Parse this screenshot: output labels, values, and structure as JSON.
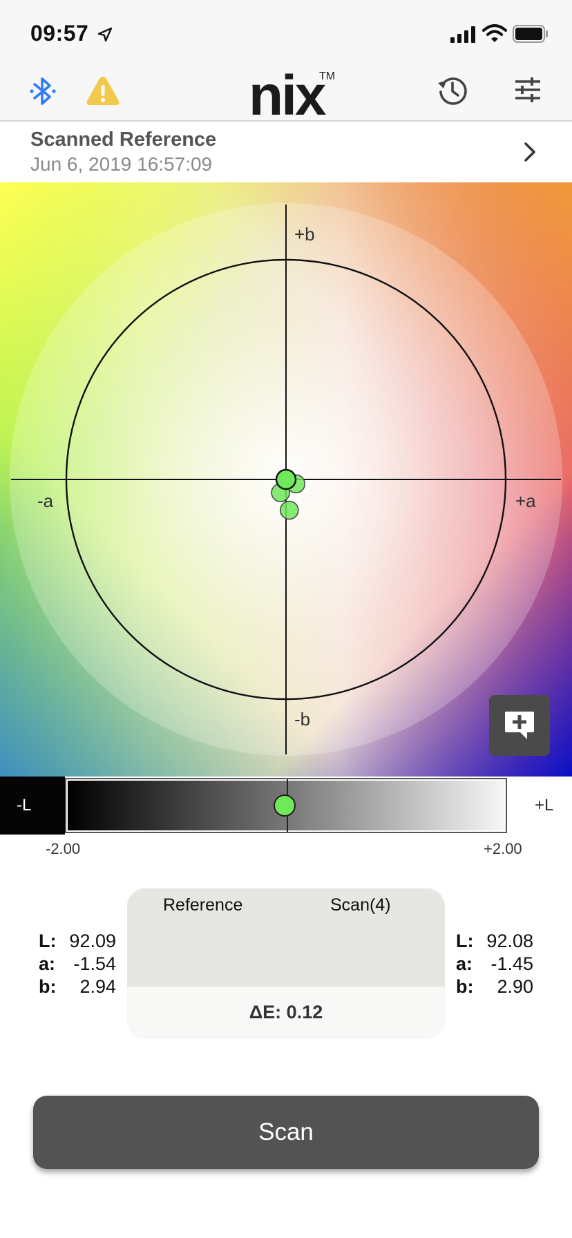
{
  "status_bar": {
    "time": "09:57",
    "icons": [
      "location-arrow-icon",
      "cellular-signal-icon",
      "wifi-icon",
      "battery-icon"
    ]
  },
  "nav": {
    "logo": "nix",
    "logo_mark": "TM",
    "icons": [
      "bluetooth-icon",
      "warning-icon",
      "history-icon",
      "settings-sliders-icon"
    ],
    "colors": {
      "bluetooth": "#2f7bf5",
      "warning": "#f2c94c"
    }
  },
  "reference": {
    "title": "Scanned Reference",
    "date": "Jun 6, 2019  16:57:09"
  },
  "color_map": {
    "axis_labels": {
      "plus_b": "+b",
      "minus_b": "-b",
      "minus_a": "-a",
      "plus_a": "+a"
    },
    "points": [
      {
        "name": "reference",
        "da": 0.0,
        "db": 0.0,
        "color": "#6fe85a"
      },
      {
        "name": "scan-1",
        "da": 0.09,
        "db": -0.04,
        "color": "#6fe85a"
      },
      {
        "name": "scan-2",
        "da": -0.05,
        "db": -0.12,
        "color": "#6fe85a"
      },
      {
        "name": "scan-3",
        "da": 0.03,
        "db": -0.28,
        "color": "#6fe85a"
      }
    ],
    "comment_icon": "add-comment-icon"
  },
  "l_bar": {
    "minus_label": "-L",
    "plus_label": "+L",
    "min": "-2.00",
    "max": "+2.00",
    "dL": -0.01
  },
  "comparison": {
    "reference_label": "Reference",
    "scan_label": "Scan(4)",
    "reference_values": {
      "L": "92.09",
      "a": "-1.54",
      "b": "2.94"
    },
    "scan_values": {
      "L": "92.08",
      "a": "-1.45",
      "b": "2.90"
    },
    "keys": {
      "L": "L:",
      "a": "a:",
      "b": "b:"
    },
    "delta_e": "ΔE: 0.12"
  },
  "scan_button": {
    "label": "Scan"
  }
}
